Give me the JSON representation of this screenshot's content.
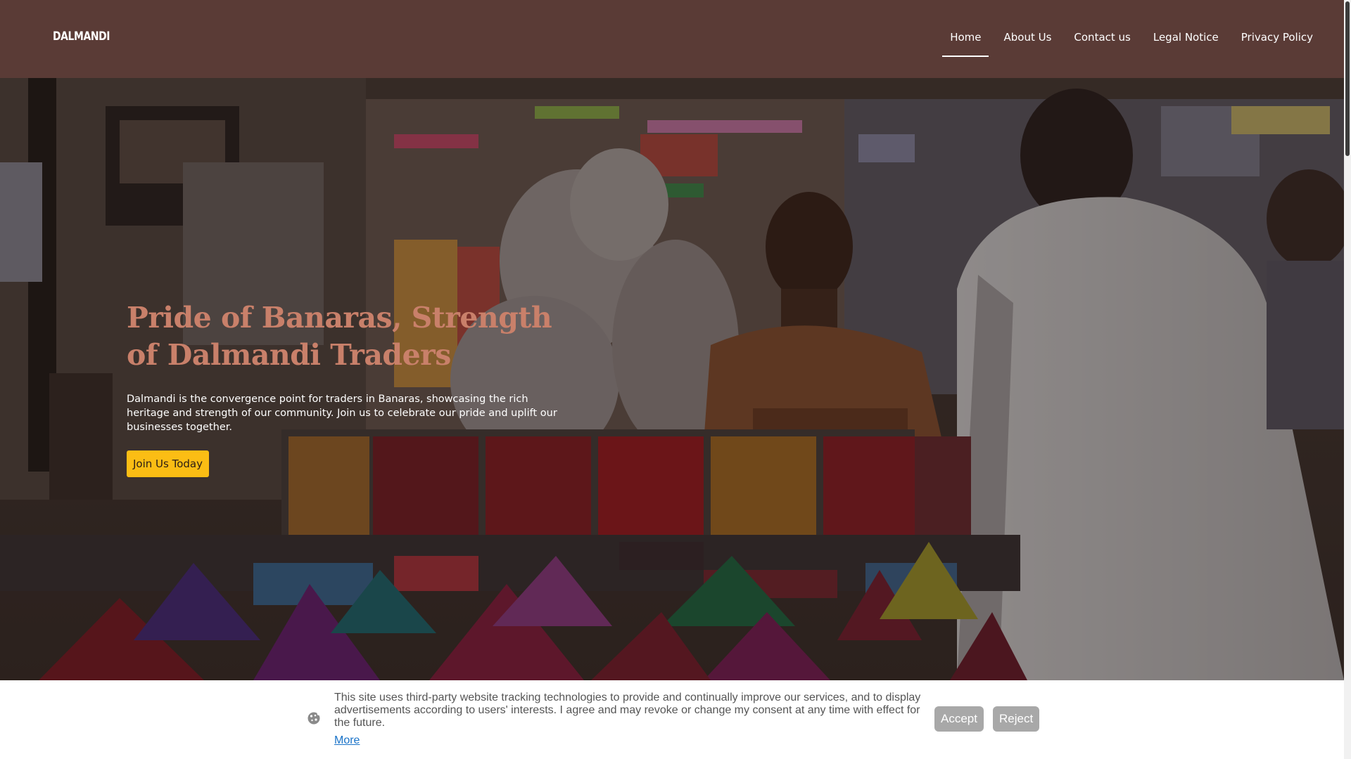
{
  "header": {
    "logo": "DALMANDI",
    "nav": [
      {
        "label": "Home",
        "active": true
      },
      {
        "label": "About Us",
        "active": false
      },
      {
        "label": "Contact us",
        "active": false
      },
      {
        "label": "Legal Notice",
        "active": false
      },
      {
        "label": "Privacy Policy",
        "active": false
      }
    ]
  },
  "hero": {
    "title": "Pride of Banaras, Strength of Dalmandi Traders",
    "text": "Dalmandi is the convergence point for traders in Banaras, showcasing the rich heritage and strength of our community. Join us to celebrate our pride and uplift our businesses together.",
    "cta_label": "Join Us Today",
    "image_icon": "market-stall-photo"
  },
  "cookie": {
    "icon": "cookie-icon",
    "text": "This site uses third-party website tracking technologies to provide and continually improve our services, and to display advertisements according to users' interests. I agree and may revoke or change my consent at any time with effect for the future.",
    "more_label": "More",
    "accept_label": "Accept",
    "reject_label": "Reject"
  },
  "colors": {
    "header_bg": "#5a3b36",
    "title": "#c9806a",
    "cta_bg": "#fbbd14",
    "cookie_button": "#a8a8a8",
    "link": "#1a73c8"
  }
}
